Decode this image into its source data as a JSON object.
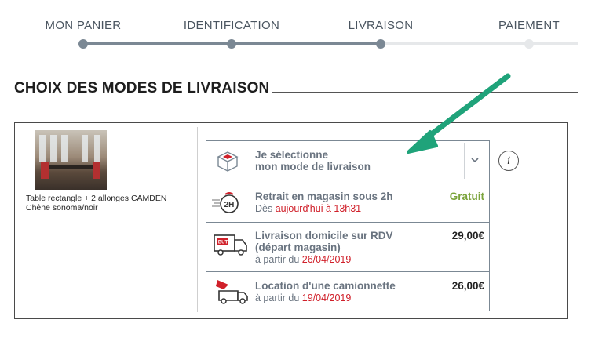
{
  "steps": [
    {
      "label": "MON PANIER",
      "state": "done"
    },
    {
      "label": "IDENTIFICATION",
      "state": "done"
    },
    {
      "label": "LIVRAISON",
      "state": "current"
    },
    {
      "label": "PAIEMENT",
      "state": "todo"
    }
  ],
  "section_title": "CHOIX DES MODES DE LIVRAISON",
  "product": {
    "name_line1": "Table rectangle + 2 allonges CAMDEN",
    "name_line2": "Chêne sonoma/noir",
    "image_icon": "product-photo"
  },
  "selector": {
    "line1": "Je sélectionne",
    "line2": "mon mode de livraison",
    "icon": "open-box-icon",
    "dropdown_icon": "chevron-down-icon"
  },
  "info_label": "i",
  "options": [
    {
      "title": "Retrait en magasin sous 2h",
      "sub_prefix": "Dès ",
      "sub_highlight": "aujourd'hui à 13h31",
      "price": "Gratuit",
      "icon": "2h-timer-icon"
    },
    {
      "title_line1": "Livraison domicile sur RDV",
      "title_line2": "(départ magasin)",
      "sub_prefix": "à partir du ",
      "sub_highlight": "26/04/2019",
      "price": "29,00€",
      "icon": "delivery-truck-icon",
      "truck_text": "BUT"
    },
    {
      "title": "Location d'une camionnette",
      "sub_prefix": "à partir du ",
      "sub_highlight": "19/04/2019",
      "price": "26,00€",
      "icon": "van-rental-icon"
    }
  ],
  "colors": {
    "accent": "#7b8894",
    "highlight": "#d0202a",
    "free": "#7aa33a",
    "arrow": "#1fa37a"
  }
}
